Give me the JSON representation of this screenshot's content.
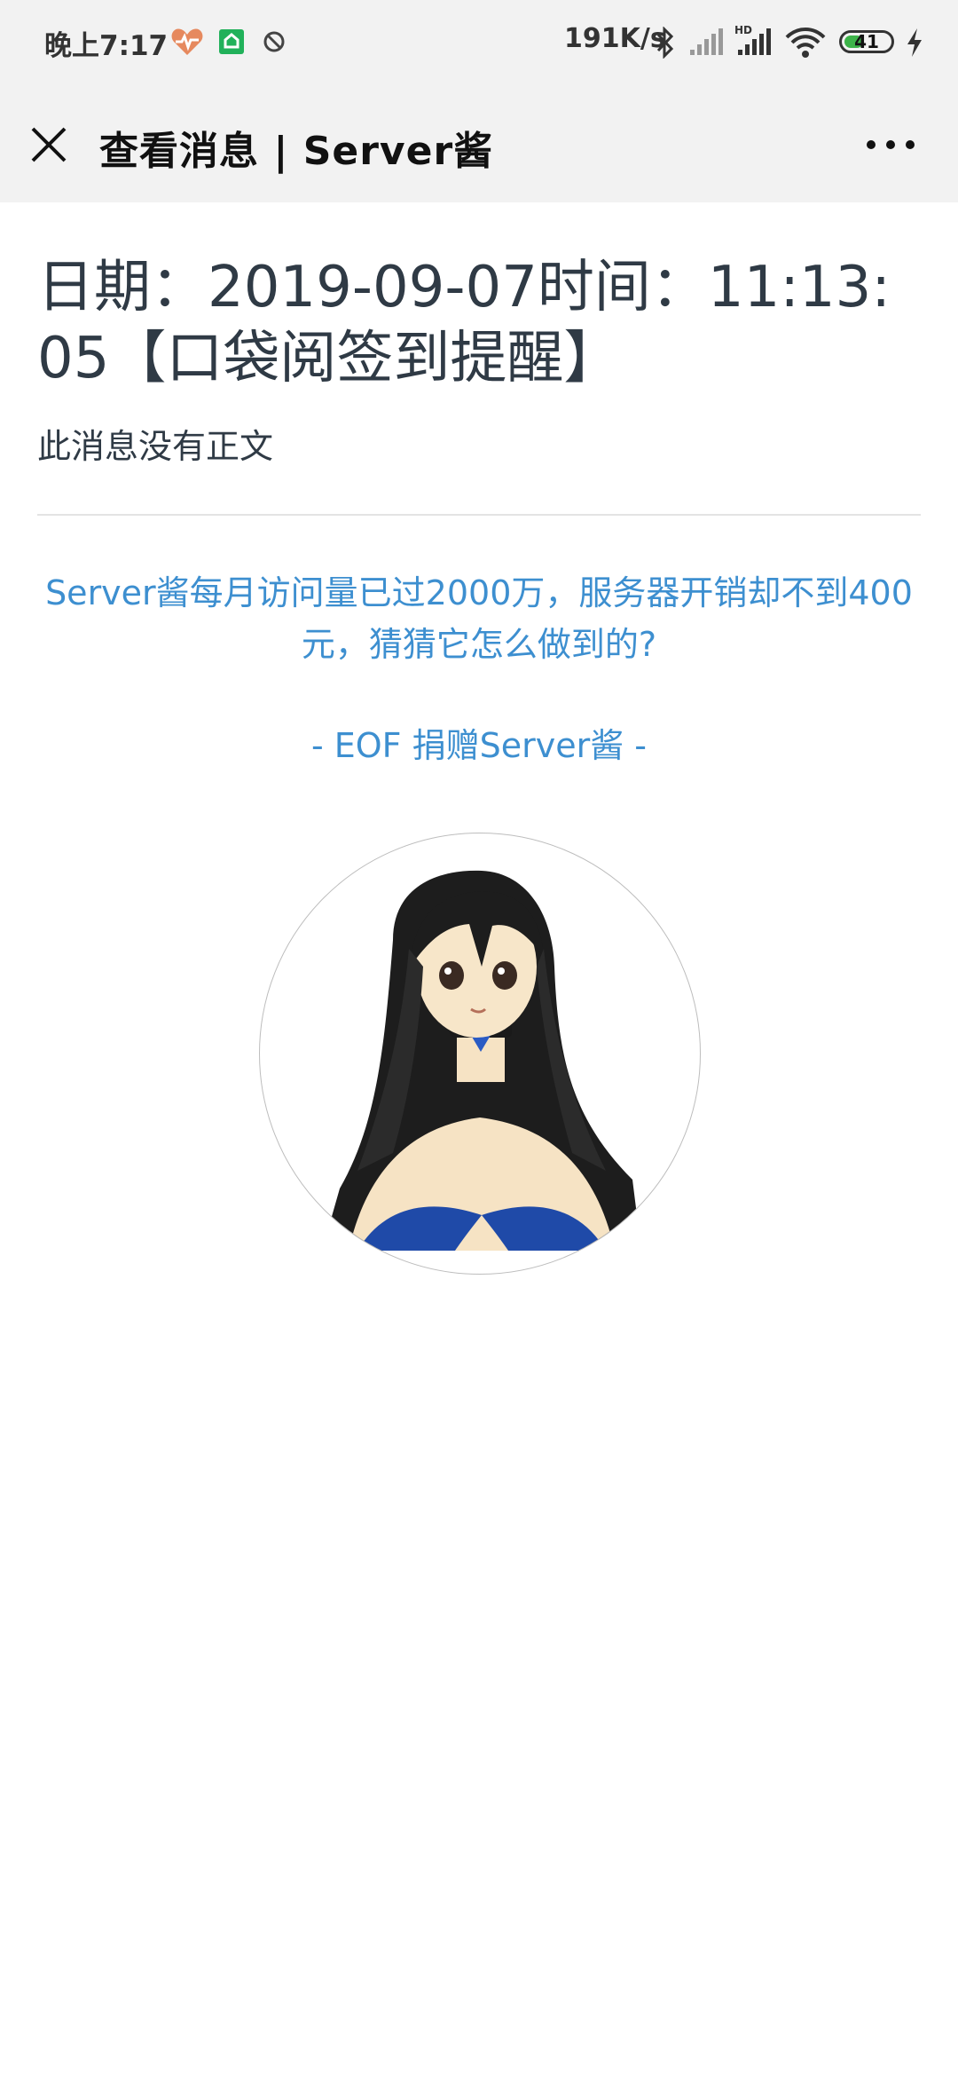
{
  "status_bar": {
    "time": "晚上7:17",
    "net_speed": "191K/s",
    "battery_level": "41",
    "battery_percent": 41,
    "icons": [
      "heart-health-icon",
      "app-notification-icon",
      "do-not-disturb-icon",
      "bluetooth-icon",
      "signal-icon",
      "hd-signal-icon",
      "wifi-icon",
      "charging-icon"
    ]
  },
  "navbar": {
    "title": "查看消息 | Server酱",
    "close_icon": "close-icon",
    "more_icon": "more-dots-icon"
  },
  "message": {
    "title": "日期：2019-09-07时间：11:13:05【口袋阅签到提醒】",
    "body": "此消息没有正文"
  },
  "promo": {
    "text": "Server酱每月访问量已过2000万，服务器开销却不到400元，猜猜它怎么做到的?",
    "donate": "- EOF 捐赠Server酱 -"
  },
  "colors": {
    "accent": "#3d8fd0",
    "battery": "#3db349",
    "bar_bg": "#f2f2f2"
  }
}
